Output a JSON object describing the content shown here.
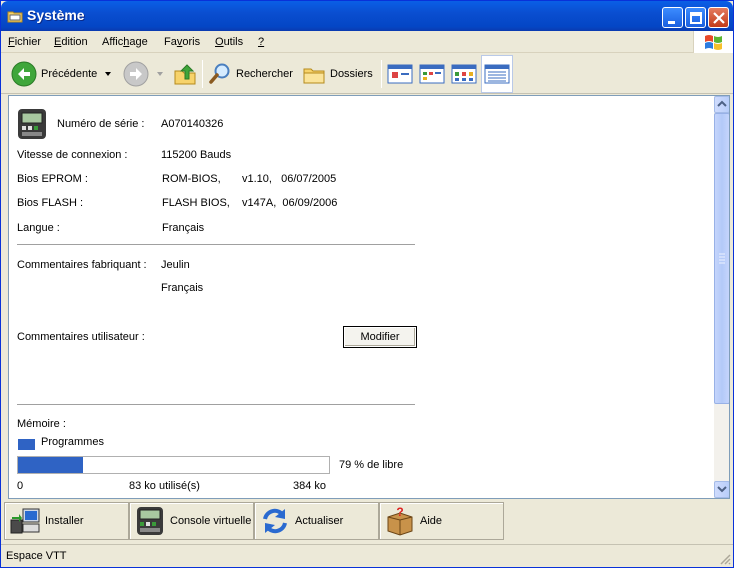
{
  "window": {
    "title": "Système"
  },
  "menu": [
    {
      "label_u": "F",
      "label_rest": "ichier"
    },
    {
      "label_u": "E",
      "label_rest": "dition"
    },
    {
      "label_pre": "Affic",
      "label_u": "h",
      "label_rest": "age"
    },
    {
      "label_pre": "Fa",
      "label_u": "v",
      "label_rest": "oris"
    },
    {
      "label_u": "O",
      "label_rest": "utils"
    },
    {
      "label_u": "?",
      "label_rest": ""
    }
  ],
  "toolbar": {
    "back_label": "Précédente",
    "search_label": "Rechercher",
    "folders_label": "Dossiers"
  },
  "info": {
    "serial_label": "Numéro de série :",
    "serial_value": "A070140326",
    "speed_label": "Vitesse de connexion :",
    "speed_value": "115200 Bauds",
    "eprom_label": "Bios EPROM :",
    "eprom_name": "ROM-BIOS,",
    "eprom_version": "v1.10,   06/07/2005",
    "flash_label": "Bios FLASH :",
    "flash_name": "FLASH BIOS,",
    "flash_version": "v147A,  06/09/2006",
    "lang_label": "Langue :",
    "lang_value": "Français"
  },
  "comments": {
    "maker_label": "Commentaires fabriquant :",
    "maker_line1": "Jeulin",
    "maker_line2": "Français",
    "user_label": "Commentaires utilisateur :",
    "modify_button": "Modifier"
  },
  "memory": {
    "label": "Mémoire :",
    "legend": "Programmes",
    "used_fraction": 0.21,
    "free_text": "79 % de libre",
    "scale_min": "0",
    "used_text": "83 ko utilisé(s)",
    "scale_max": "384 ko"
  },
  "bottom": {
    "install": "Installer",
    "console": "Console virtuelle",
    "refresh": "Actualiser",
    "help": "Aide"
  },
  "status": {
    "text": "Espace VTT"
  },
  "colors": {
    "title_blue": "#0a4ed0",
    "bar_blue": "#2f63c4"
  }
}
